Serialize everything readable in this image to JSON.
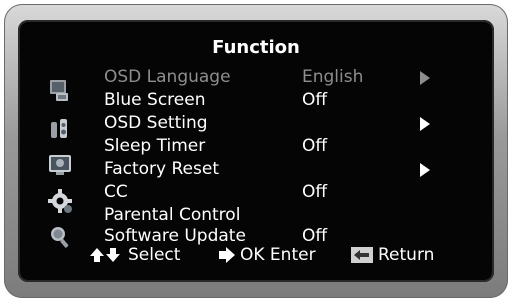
{
  "title": "Function",
  "menu": [
    {
      "label": "OSD Language",
      "value": "English",
      "arrow": true,
      "state": "highlighted"
    },
    {
      "label": "Blue Screen",
      "value": "Off",
      "arrow": false,
      "state": "normal"
    },
    {
      "label": "OSD Setting",
      "value": "",
      "arrow": true,
      "state": "normal"
    },
    {
      "label": "Sleep Timer",
      "value": "Off",
      "arrow": false,
      "state": "normal"
    },
    {
      "label": "Factory Reset",
      "value": "",
      "arrow": true,
      "state": "normal"
    },
    {
      "label": "CC",
      "value": "Off",
      "arrow": false,
      "state": "normal"
    },
    {
      "label": "Parental Control",
      "value": "",
      "arrow": false,
      "state": "normal"
    },
    {
      "label": "Software Update",
      "value": "Off",
      "arrow": false,
      "state": "normal"
    }
  ],
  "side_icons": [
    "picture-icon",
    "sound-icon",
    "channel-icon",
    "function-gear-icon",
    "search-icon"
  ],
  "footer": {
    "select_label": "Select",
    "ok_label": "OK Enter",
    "return_label": "Return"
  },
  "colors": {
    "background": "#050505",
    "text": "#ffffff",
    "dim_text": "#8e8e8e"
  }
}
